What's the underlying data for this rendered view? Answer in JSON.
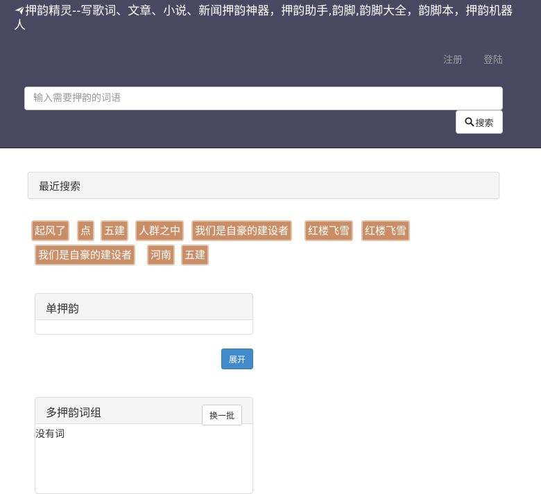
{
  "header": {
    "title": "押韵精灵--写歌词、文章、小说、新闻押韵神器，押韵助手,韵脚,韵脚大全，韵脚本，押韵机器人",
    "nav": {
      "register": "注册",
      "login": "登陆"
    },
    "search": {
      "placeholder": "输入需要押韵的词语",
      "button_label": "搜索"
    }
  },
  "recent": {
    "title": "最近搜索",
    "tags": [
      "起风了",
      "点",
      "五建",
      "人群之中",
      "我们是自豪的建设者",
      "红楼飞雪",
      "红楼飞雪",
      "我们是自豪的建设者",
      "河南",
      "五建"
    ]
  },
  "single_rhyme": {
    "title": "单押韵",
    "expand_label": "展开"
  },
  "multi_rhyme": {
    "title": "多押韵词组",
    "swap_label": "换一批",
    "empty_text": "没有词"
  },
  "colors": {
    "header_bg": "#4a4760",
    "tag_bg": "#c98e66",
    "primary": "#428bca"
  },
  "icons": {
    "brand": "paper-plane-icon",
    "search": "search-icon"
  }
}
